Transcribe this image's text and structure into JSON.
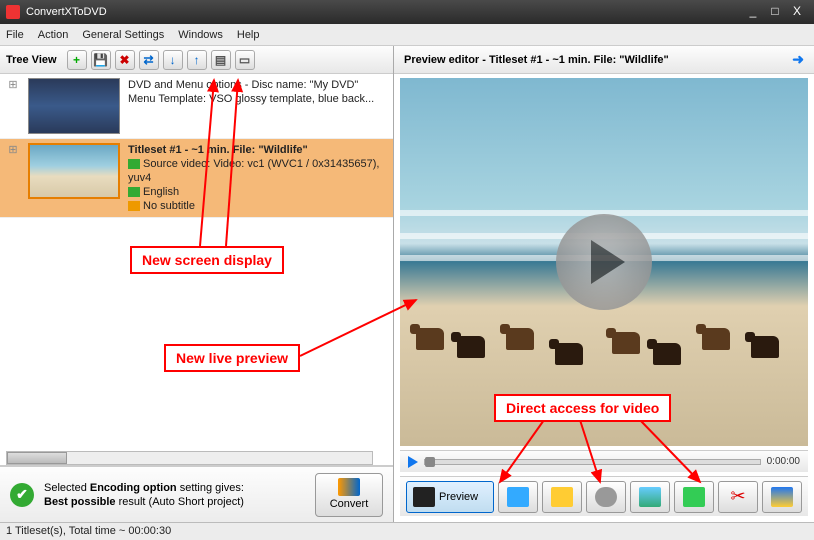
{
  "window": {
    "title": "ConvertXToDVD"
  },
  "menubar": {
    "file": "File",
    "action": "Action",
    "general": "General Settings",
    "windows": "Windows",
    "help": "Help"
  },
  "left_toolbar": {
    "label": "Tree View"
  },
  "tree": {
    "menu": {
      "line1": "DVD and Menu options - Disc name: \"My DVD\"",
      "line2": "Menu Template: VSO glossy template, blue back..."
    },
    "title1": {
      "header": "Titleset #1 - ~1 min. File: \"Wildlife\"",
      "source": "Source video: Video: vc1 (WVC1 / 0x31435657), yuv4",
      "audio": "English",
      "subtitle": "No subtitle"
    }
  },
  "quality": {
    "line1_a": "Selected ",
    "line1_b": "Encoding option",
    "line1_c": " setting gives:",
    "line2_a": "Best possible",
    "line2_b": " result (Auto Short project)"
  },
  "convert_label": "Convert",
  "preview": {
    "header": "Preview editor - Titleset #1 - ~1 min. File: \"Wildlife\"",
    "time": "0:00:00",
    "tab_preview": "Preview"
  },
  "status": "1 Titleset(s), Total time ~ 00:00:30",
  "annotations": {
    "a1": "New screen display",
    "a2": "New live preview",
    "a3": "Direct access for video"
  }
}
